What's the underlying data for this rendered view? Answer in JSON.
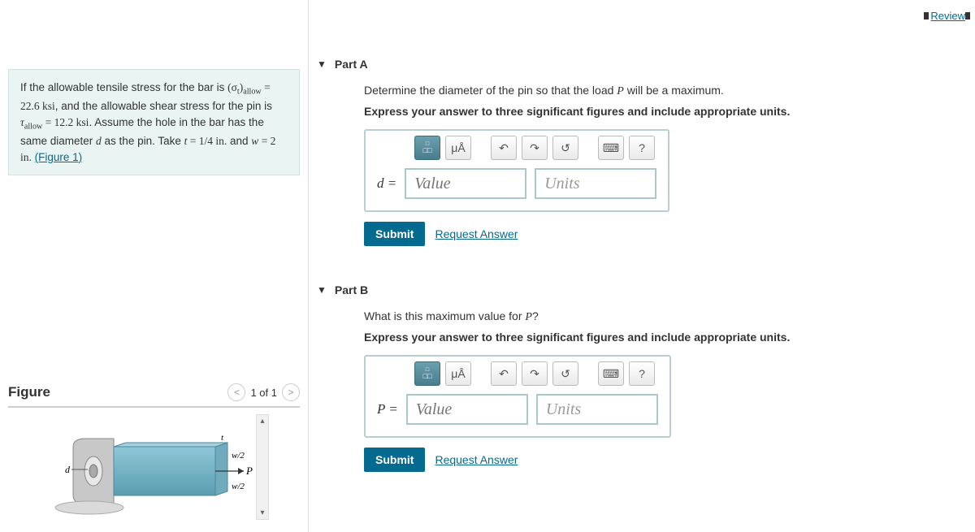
{
  "header": {
    "review_label": "Review"
  },
  "problem": {
    "text_1": "If the allowable tensile stress for the bar is ",
    "sigma_label": "(σ",
    "sigma_sub": "t",
    "sigma_close": ")",
    "allow_sub": "allow",
    "eq1": " = 22.6 ksi",
    "text_2": ", and the allowable shear stress for the pin is ",
    "tau_label": "τ",
    "eq2": " = 12.2 ksi",
    "text_3": ". Assume the hole in the bar has the same diameter ",
    "d_var": "d",
    "text_4": " as the pin. Take ",
    "t_var": "t",
    "t_val": " = 1/4 in.",
    "text_5": " and ",
    "w_var": "w",
    "w_val": " = 2 in.",
    "figure_link": "(Figure 1)"
  },
  "figure": {
    "title": "Figure",
    "counter": "1 of 1",
    "labels": {
      "d": "d",
      "t": "t",
      "w1": "w/2",
      "w2": "w/2",
      "P": "P"
    }
  },
  "parts": {
    "a": {
      "title": "Part A",
      "prompt_pre": "Determine the diameter of the pin so that the load ",
      "prompt_var": "P",
      "prompt_post": " will be a maximum.",
      "instruction": "Express your answer to three significant figures and include appropriate units.",
      "var": "d",
      "eq": " = ",
      "value_ph": "Value",
      "units_ph": "Units",
      "submit": "Submit",
      "request": "Request Answer"
    },
    "b": {
      "title": "Part B",
      "prompt_pre": "What is this maximum value for ",
      "prompt_var": "P",
      "prompt_post": "?",
      "instruction": "Express your answer to three significant figures and include appropriate units.",
      "var": "P",
      "eq": " = ",
      "value_ph": "Value",
      "units_ph": "Units",
      "submit": "Submit",
      "request": "Request Answer"
    }
  },
  "toolbar": {
    "units_symbol": "μÅ",
    "help": "?"
  }
}
